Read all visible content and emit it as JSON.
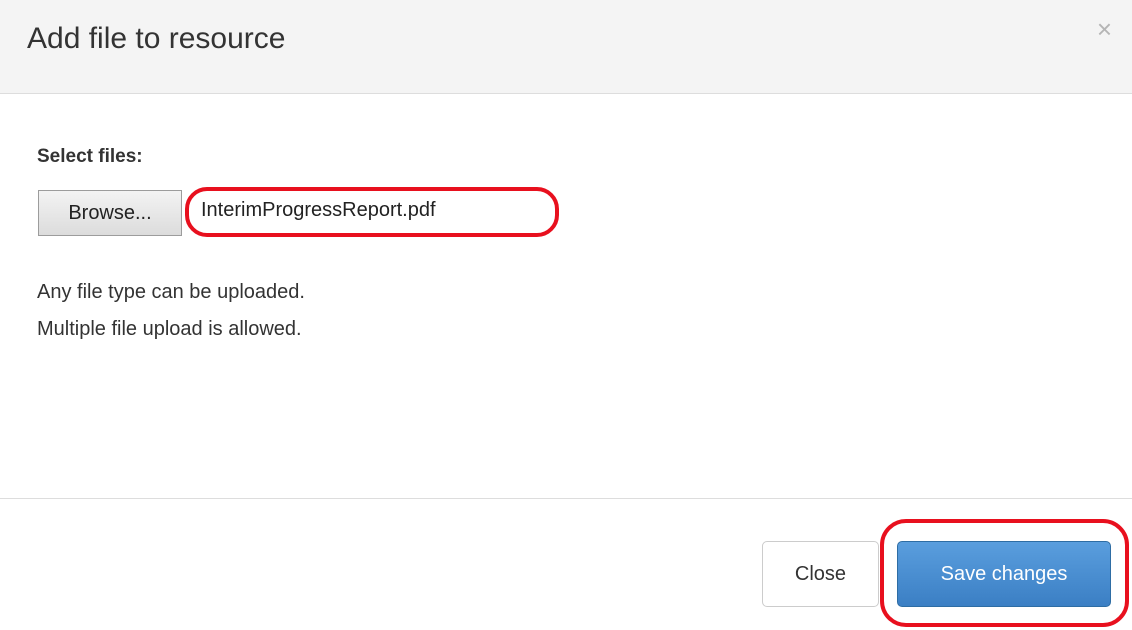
{
  "modal": {
    "title": "Add file to resource",
    "close_icon": "close-icon",
    "close_glyph": "×"
  },
  "form": {
    "select_label": "Select files:",
    "browse_label": "Browse...",
    "selected_file": "InterimProgressReport.pdf",
    "help_lines": [
      "Any file type can be uploaded.",
      "Multiple file upload is allowed."
    ]
  },
  "footer": {
    "close_label": "Close",
    "save_label": "Save changes"
  },
  "colors": {
    "primary": "#428bca",
    "highlight": "#e8101e",
    "header_bg": "#f4f4f4"
  }
}
